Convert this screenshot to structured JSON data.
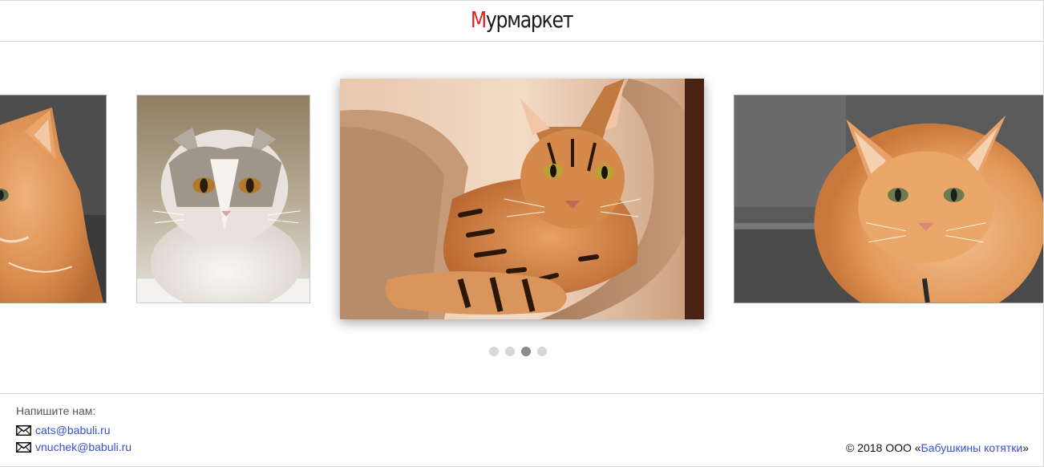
{
  "header": {
    "logo_first_letter": "М",
    "logo_rest": "урмаркет",
    "accent_color": "#e01c1c"
  },
  "carousel": {
    "slides": [
      {
        "subject": "ginger long-haired cat (cropped)"
      },
      {
        "subject": "grey-and-white fluffy cat"
      },
      {
        "subject": "bengal cat in a cat bed"
      },
      {
        "subject": "ginger long-haired cat"
      }
    ],
    "dots": [
      {
        "active": false
      },
      {
        "active": false
      },
      {
        "active": true
      },
      {
        "active": false
      }
    ]
  },
  "footer": {
    "write_us": "Напишите нам:",
    "emails": [
      "cats@babuli.ru",
      "vnuchek@babuli.ru"
    ],
    "copyright_prefix": "© 2018 ООО «",
    "company_name": "Бабушкины котятки",
    "copyright_suffix": "»",
    "link_color": "#3a4fd0"
  }
}
